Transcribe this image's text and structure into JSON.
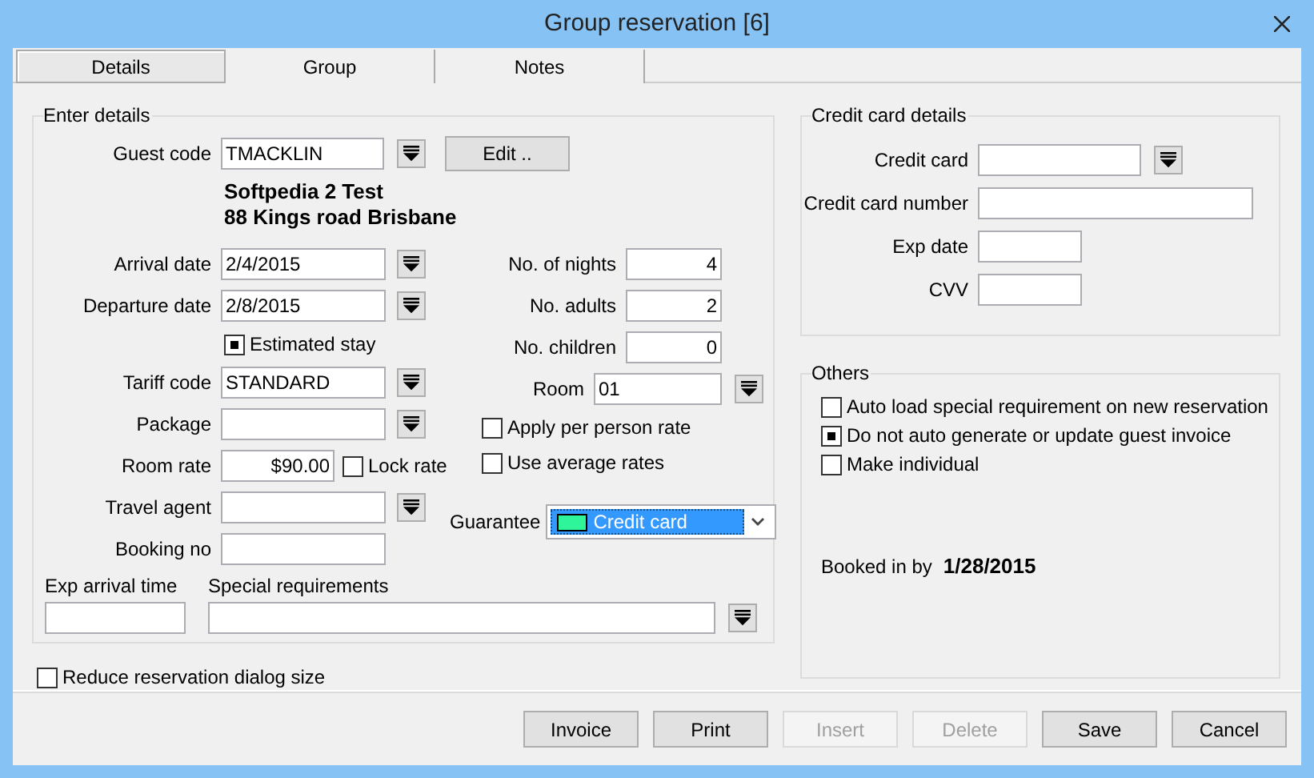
{
  "window": {
    "title": "Group reservation [6]"
  },
  "tabs": [
    {
      "label": "Details",
      "selected": true
    },
    {
      "label": "Group",
      "selected": false
    },
    {
      "label": "Notes",
      "selected": false
    }
  ],
  "details": {
    "title": "Enter details",
    "guest_code": {
      "label": "Guest code",
      "value": "TMACKLIN"
    },
    "edit_button": "Edit ..",
    "guest_lines": [
      "Softpedia 2 Test",
      "88 Kings road Brisbane"
    ],
    "left_rows": [
      {
        "kind": "lookup",
        "label": "Arrival date",
        "value": "2/4/2015"
      },
      {
        "kind": "lookup",
        "label": "Departure date",
        "value": "2/8/2015"
      },
      {
        "kind": "checkbox",
        "label": "Estimated stay",
        "checked": true
      },
      {
        "kind": "lookup",
        "label": "Tariff code",
        "value": "STANDARD"
      },
      {
        "kind": "lookup",
        "label": "Package"
      },
      {
        "kind": "rate",
        "label": "Room rate",
        "value": "$90.00",
        "lock": {
          "label": "Lock rate",
          "checked": false
        }
      },
      {
        "kind": "lookup",
        "label": "Travel agent"
      },
      {
        "kind": "text",
        "label": "Booking no"
      }
    ],
    "right_rows": [
      {
        "kind": "number",
        "label": "No. of nights",
        "value": "4"
      },
      {
        "kind": "number",
        "label": "No. adults",
        "value": "2"
      },
      {
        "kind": "number",
        "label": "No. children",
        "value": "0"
      },
      {
        "kind": "lookup",
        "label": "Room",
        "value": "01"
      },
      {
        "kind": "checkbox",
        "label": "Apply per person rate",
        "checked": false
      },
      {
        "kind": "checkbox",
        "label": "Use average rates",
        "checked": false
      },
      {
        "kind": "combo",
        "label": "Guarantee",
        "value": "Credit card",
        "color": "#2ef59a"
      }
    ],
    "exp_arrival_time": {
      "label": "Exp arrival time"
    },
    "special_requirements": {
      "label": "Special requirements"
    }
  },
  "reduce_dialog": {
    "label": "Reduce reservation dialog size",
    "checked": false
  },
  "credit_card": {
    "title": "Credit card details",
    "fields": [
      {
        "kind": "lookup",
        "label": "Credit card"
      },
      {
        "kind": "wide",
        "label": "Credit card number"
      },
      {
        "kind": "short",
        "label": "Exp date"
      },
      {
        "kind": "short",
        "label": "CVV"
      }
    ]
  },
  "others": {
    "title": "Others",
    "options": [
      {
        "label": "Auto load special requirement on new reservation",
        "checked": false
      },
      {
        "label": "Do not auto generate or update guest invoice",
        "checked": true
      },
      {
        "label": "Make individual",
        "checked": false
      }
    ],
    "booked_in_by": {
      "label": "Booked in by",
      "value": "1/28/2015"
    }
  },
  "buttons": [
    {
      "label": "Invoice",
      "disabled": false
    },
    {
      "label": "Print",
      "disabled": false
    },
    {
      "label": "Insert",
      "disabled": true
    },
    {
      "label": "Delete",
      "disabled": true
    },
    {
      "label": "Save",
      "disabled": false
    },
    {
      "label": "Cancel",
      "disabled": false
    }
  ]
}
